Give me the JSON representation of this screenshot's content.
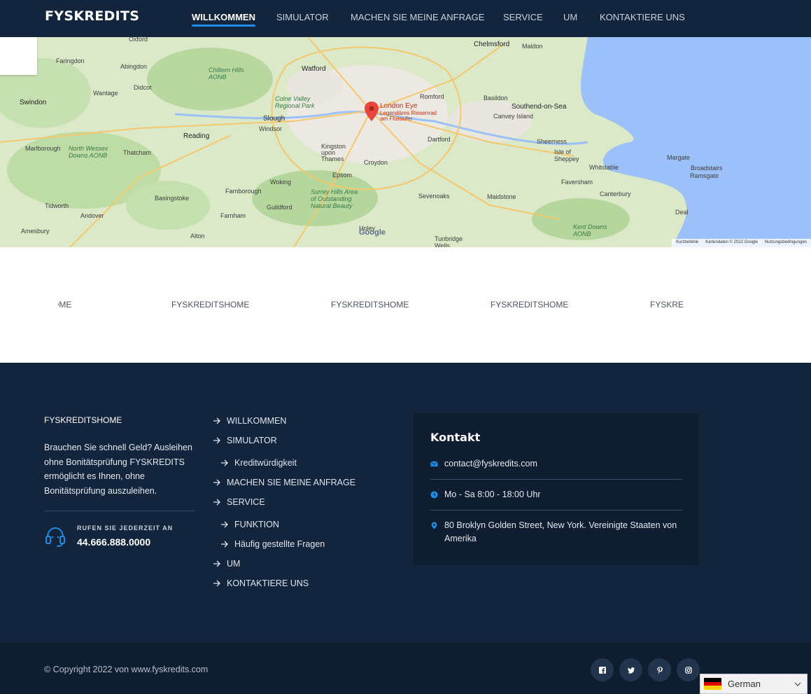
{
  "nav": {
    "brand": "FYSKREDITS",
    "items": [
      {
        "label": "WILLKOMMEN"
      },
      {
        "label": "SIMULATOR"
      },
      {
        "label": "MACHEN SIE MEINE ANFRAGE"
      },
      {
        "label": "SERVICE"
      },
      {
        "label": "UM"
      },
      {
        "label": "KONTAKTIERE UNS"
      }
    ],
    "accent_color": "#1f8ce6",
    "bg_color": "#13253d"
  },
  "map": {
    "pin_label_1": "London Eye",
    "pin_label_2": "Legendäres Riesenrad",
    "pin_label_3": "am Flussufer",
    "places": [
      "Oxford",
      "Abingdon",
      "Faringdon",
      "Chiltern Hills AONB",
      "Watford",
      "Chelmsford",
      "Maldon",
      "Didcot",
      "Wantage",
      "Swindon",
      "Colne Valley Regional Park",
      "Romford",
      "Basildon",
      "Southend-on-Sea",
      "Canvey Island",
      "Slough",
      "Windsor",
      "Reading",
      "Marlborough",
      "North Wessex Downs AONB",
      "Thatcham",
      "Kingston upon Thames",
      "Croydon",
      "Dartford",
      "Sheerness",
      "Isle of Sheppey",
      "Margate",
      "Broadstairs",
      "Ramsgate",
      "Whitstable",
      "Faversham",
      "Canterbury",
      "Woking",
      "Epsom",
      "Basingstoke",
      "Farnborough",
      "Guildford",
      "Surrey Hills Area of Outstanding Natural Beauty",
      "Sevenoaks",
      "Maidstone",
      "Tidworth",
      "Andover",
      "Farnham",
      "Deal",
      "Kent Downs AONB",
      "Amesbury",
      "Alton",
      "Holey",
      "Tunbridge Wells",
      "Google"
    ],
    "attribution": [
      "Kurzbefehle",
      "Kartendaten © 2022 Google",
      "Nutzungsbedingungen"
    ]
  },
  "marquee": {
    "items": [
      "TSHOME",
      "FYSKREDITSHOME",
      "FYSKREDITSHOME",
      "FYSKREDITSHOME",
      "FYSKRE"
    ]
  },
  "footer": {
    "brand": "FYSKREDITSHOME",
    "description": "Brauchen Sie schnell Geld? Ausleihen ohne Bonitätsprüfung FYSKREDITS ermöglicht es Ihnen, ohne Bonitätsprüfung auszuleihen.",
    "call_label": "RUFEN SIE JEDERZEIT AN",
    "call_number": "44.666.888.0000",
    "links": [
      {
        "label": "WILLKOMMEN"
      },
      {
        "label": "SIMULATOR"
      },
      {
        "label": "Kreditwürdigkeit"
      },
      {
        "label": "MACHEN SIE MEINE ANFRAGE"
      },
      {
        "label": "SERVICE"
      },
      {
        "label": "FUNKTION"
      },
      {
        "label": "Häufig gestellte Fragen"
      },
      {
        "label": "UM"
      },
      {
        "label": "KONTAKTIERE UNS"
      }
    ],
    "contact": {
      "title": "Kontakt",
      "email": "contact@fyskredits.com",
      "hours": "Mo - Sa 8:00 - 18:00 Uhr",
      "address": "80 Broklyn Golden Street, New York. Vereinigte Staaten von Amerika"
    }
  },
  "bottom": {
    "copyright": "© Copyright 2022 von www.fyskredits.com",
    "social": [
      "facebook-icon",
      "twitter-icon",
      "pinterest-icon",
      "instagram-icon"
    ]
  },
  "language": {
    "selected": "German"
  }
}
